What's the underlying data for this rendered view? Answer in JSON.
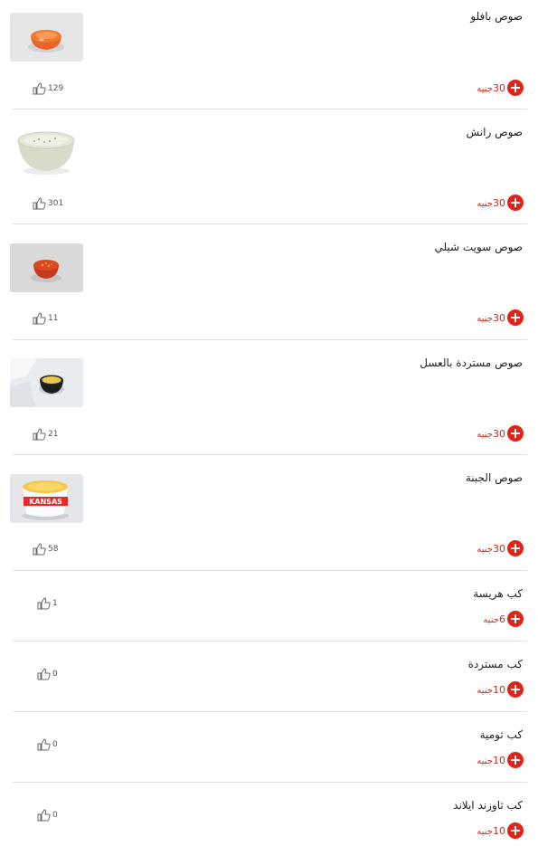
{
  "currency": "جنيه",
  "items": [
    {
      "name": "صوص بافلو",
      "price": "30",
      "likes": "129",
      "image": "buffalo-sauce-cup"
    },
    {
      "name": "صوص رانش",
      "price": "30",
      "likes": "301",
      "image": "ranch-sauce-bowl"
    },
    {
      "name": "صوص سويت شيلي",
      "price": "30",
      "likes": "11",
      "image": "sweet-chili-sauce-cup"
    },
    {
      "name": "صوص مستردة بالعسل",
      "price": "30",
      "likes": "21",
      "image": "honey-mustard-sauce-cup"
    },
    {
      "name": "صوص الجبنة",
      "price": "30",
      "likes": "58",
      "image": "cheese-sauce-cup",
      "image_text": "KANSAS"
    },
    {
      "name": "كب هريسة",
      "price": "6",
      "likes": "1"
    },
    {
      "name": "كب مستردة",
      "price": "10",
      "likes": "0"
    },
    {
      "name": "كب ثومية",
      "price": "10",
      "likes": "0"
    },
    {
      "name": "كب ثاوزند ايلاند",
      "price": "10",
      "likes": "0"
    }
  ],
  "colors": {
    "accent": "#e2231a",
    "price_text": "#d62a1e",
    "divider": "#e2e2e2"
  }
}
